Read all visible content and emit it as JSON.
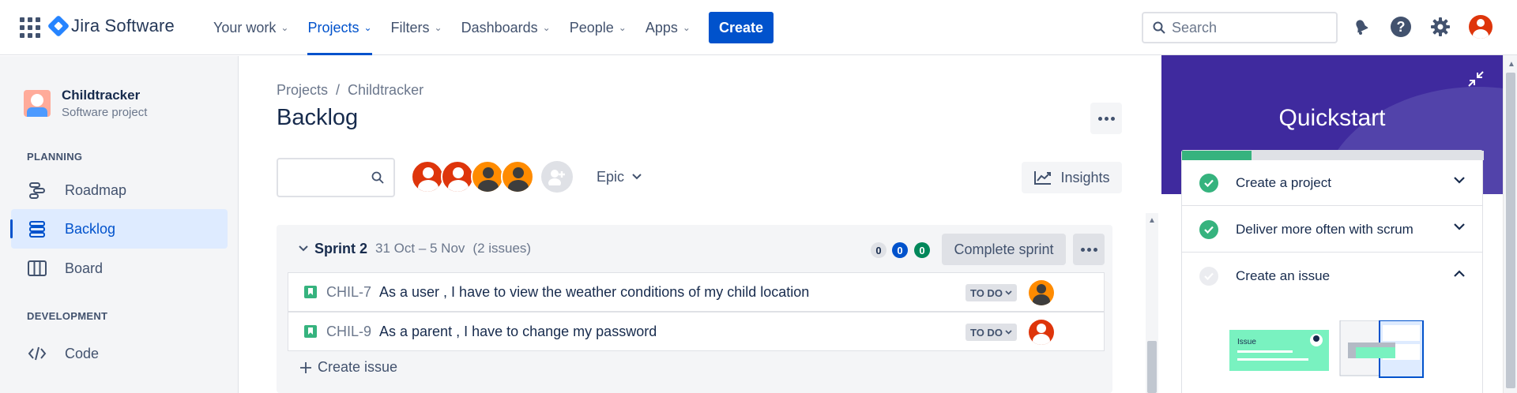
{
  "app": {
    "name": "Jira Software"
  },
  "nav": {
    "items": [
      {
        "label": "Your work"
      },
      {
        "label": "Projects"
      },
      {
        "label": "Filters"
      },
      {
        "label": "Dashboards"
      },
      {
        "label": "People"
      },
      {
        "label": "Apps"
      }
    ],
    "active": "Projects",
    "create_label": "Create",
    "search_placeholder": "Search"
  },
  "sidebar": {
    "project_name": "Childtracker",
    "project_type": "Software project",
    "planning_heading": "PLANNING",
    "planning_items": [
      {
        "label": "Roadmap",
        "icon": "roadmap-icon"
      },
      {
        "label": "Backlog",
        "icon": "backlog-icon",
        "active": true
      },
      {
        "label": "Board",
        "icon": "board-icon"
      }
    ],
    "development_heading": "DEVELOPMENT",
    "development_items": [
      {
        "label": "Code",
        "icon": "code-icon"
      }
    ]
  },
  "main": {
    "breadcrumb": {
      "root": "Projects",
      "separator": "/",
      "project": "Childtracker"
    },
    "title": "Backlog",
    "epic_filter_label": "Epic",
    "insights_label": "Insights"
  },
  "sprint": {
    "name": "Sprint 2",
    "dates": "31 Oct – 5 Nov",
    "issue_count": "(2 issues)",
    "counts": {
      "todo": "0",
      "in_progress": "0",
      "done": "0"
    },
    "complete_label": "Complete sprint",
    "issues": [
      {
        "key": "CHIL-7",
        "summary": "As a user , I have to view the weather conditions of my child location",
        "status": "TO DO",
        "assignee_color": "orange"
      },
      {
        "key": "CHIL-9",
        "summary": "As a parent , I have to change my password",
        "status": "TO DO",
        "assignee_color": "red"
      }
    ],
    "create_issue_label": "Create issue"
  },
  "quickstart": {
    "title": "Quickstart",
    "progress_fraction": 0.23,
    "items": [
      {
        "label": "Create a project",
        "done": true,
        "expanded": false
      },
      {
        "label": "Deliver more often with scrum",
        "done": true,
        "expanded": false
      },
      {
        "label": "Create an issue",
        "done": false,
        "expanded": true
      }
    ],
    "illustration_label": "Issue"
  },
  "colors": {
    "brand_blue": "#0052CC",
    "quickstart_purple": "#3F2A9E",
    "success_green": "#36B37E",
    "avatar_red": "#DE350B",
    "avatar_orange": "#FF8B00"
  }
}
